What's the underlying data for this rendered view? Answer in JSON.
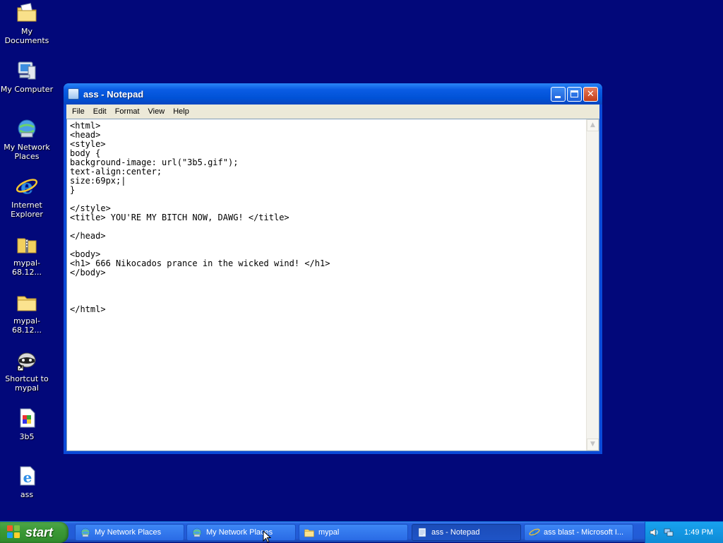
{
  "desktop": {
    "icons": [
      {
        "label": "My Documents",
        "icon": "my-documents-icon"
      },
      {
        "label": "My Computer",
        "icon": "my-computer-icon"
      },
      {
        "label": "My Network Places",
        "icon": "my-network-places-icon"
      },
      {
        "label": "Internet Explorer",
        "icon": "internet-explorer-icon"
      },
      {
        "label": "mypal-68.12...",
        "icon": "zip-folder-icon"
      },
      {
        "label": "mypal-68.12...",
        "icon": "folder-icon"
      },
      {
        "label": "Shortcut to mypal",
        "icon": "mypal-raccoon-icon"
      },
      {
        "label": "3b5",
        "icon": "gif-image-icon"
      },
      {
        "label": "ass",
        "icon": "html-document-icon"
      }
    ]
  },
  "window": {
    "title": "ass - Notepad",
    "menu": [
      "File",
      "Edit",
      "Format",
      "View",
      "Help"
    ],
    "editor_lines": [
      "<html>",
      "<head>",
      "<style>",
      "body {",
      "background-image: url(\"3b5.gif\");",
      "text-align:center;",
      "size:69px;|",
      "}",
      "",
      "</style>",
      "<title> YOU'RE MY BITCH NOW, DAWG! </title>",
      "",
      "</head>",
      "",
      "<body>",
      "<h1> 666 Nikocados prance in the wicked wind! </h1>",
      "</body>",
      "",
      "",
      "",
      "</html>"
    ]
  },
  "taskbar": {
    "start_label": "start",
    "buttons": [
      {
        "label": "My Network Places",
        "icon": "my-network-places-icon",
        "active": false
      },
      {
        "label": "My Network Places",
        "icon": "my-network-places-icon",
        "active": false
      },
      {
        "label": "mypal",
        "icon": "folder-icon",
        "active": false
      },
      {
        "label": "ass - Notepad",
        "icon": "notepad-icon",
        "active": true
      },
      {
        "label": "ass blast - Microsoft I...",
        "icon": "internet-explorer-icon",
        "active": false
      }
    ],
    "tray": {
      "icons": [
        "volume-icon",
        "network-icon"
      ],
      "clock": "1:49 PM"
    }
  },
  "colors": {
    "desktop_bg": "#02087a",
    "titlebar": "#0052d6",
    "taskbar": "#245edb",
    "start_green": "#3c9a36"
  }
}
